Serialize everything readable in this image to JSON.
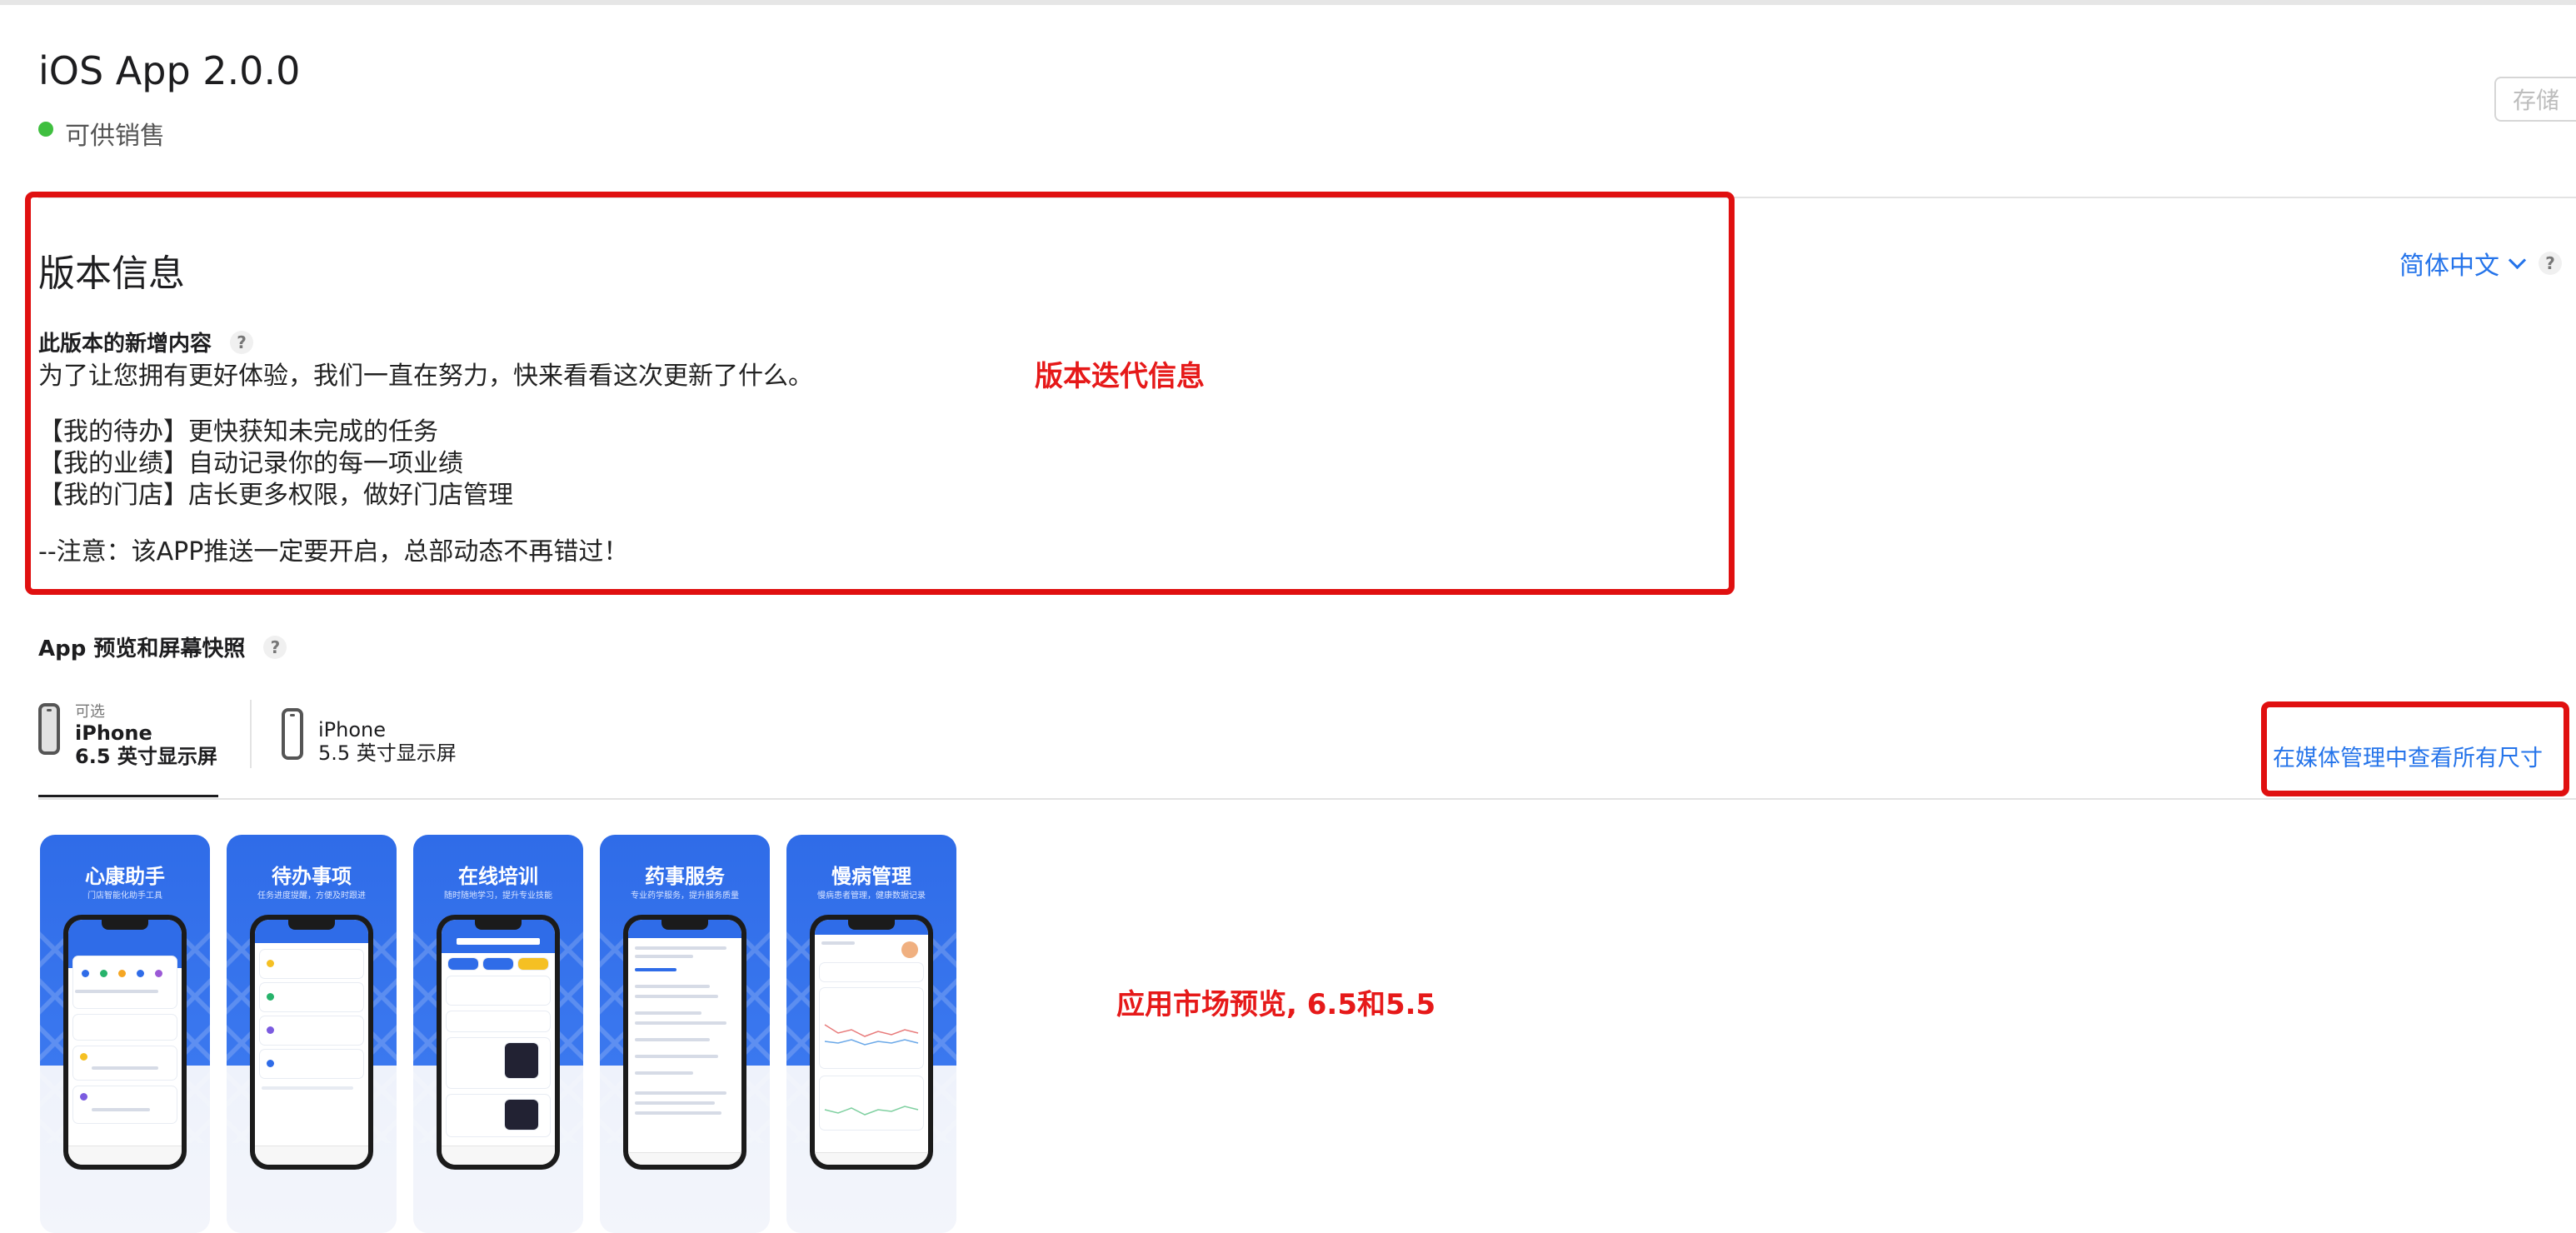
{
  "header": {
    "app_version_title": "iOS App 2.0.0",
    "status_text": "可供销售",
    "status_color": "#3fbf3f",
    "save_button_label": "存储"
  },
  "version_info": {
    "section_title": "版本信息",
    "language_selector": "简体中文",
    "whats_new_label": "此版本的新增内容",
    "help_glyph": "?",
    "intro_text": "为了让您拥有更好体验，我们一直在努力，快来看看这次更新了什么。",
    "features": [
      "【我的待办】更快获知未完成的任务",
      "【我的业绩】自动记录你的每一项业绩",
      "【我的门店】店长更多权限，做好门店管理"
    ],
    "note_text": "--注意：该APP推送一定要开启，总部动态不再错过！"
  },
  "preview": {
    "section_label": "App 预览和屏幕快照",
    "tabs": [
      {
        "optional": "可选",
        "device": "iPhone",
        "size": "6.5 英寸显示屏",
        "selected": true
      },
      {
        "optional": "",
        "device": "iPhone",
        "size": "5.5 英寸显示屏",
        "selected": false
      }
    ],
    "media_link": "在媒体管理中查看所有尺寸",
    "screenshots": [
      {
        "title": "心康助手",
        "subtitle": "门店智能化助手工具"
      },
      {
        "title": "待办事项",
        "subtitle": "任务进度提醒，方便及时跟进"
      },
      {
        "title": "在线培训",
        "subtitle": "随时随地学习，提升专业技能"
      },
      {
        "title": "药事服务",
        "subtitle": "专业药学服务，提升服务质量"
      },
      {
        "title": "慢病管理",
        "subtitle": "慢病患者管理，健康数据记录"
      }
    ]
  },
  "annotations": {
    "version_note": "版本迭代信息",
    "preview_note": "应用市场预览, 6.5和5.5",
    "highlight_color": "#e01010"
  },
  "colors": {
    "link_blue": "#2574ea",
    "brand_blue": "#2f6ce8"
  }
}
